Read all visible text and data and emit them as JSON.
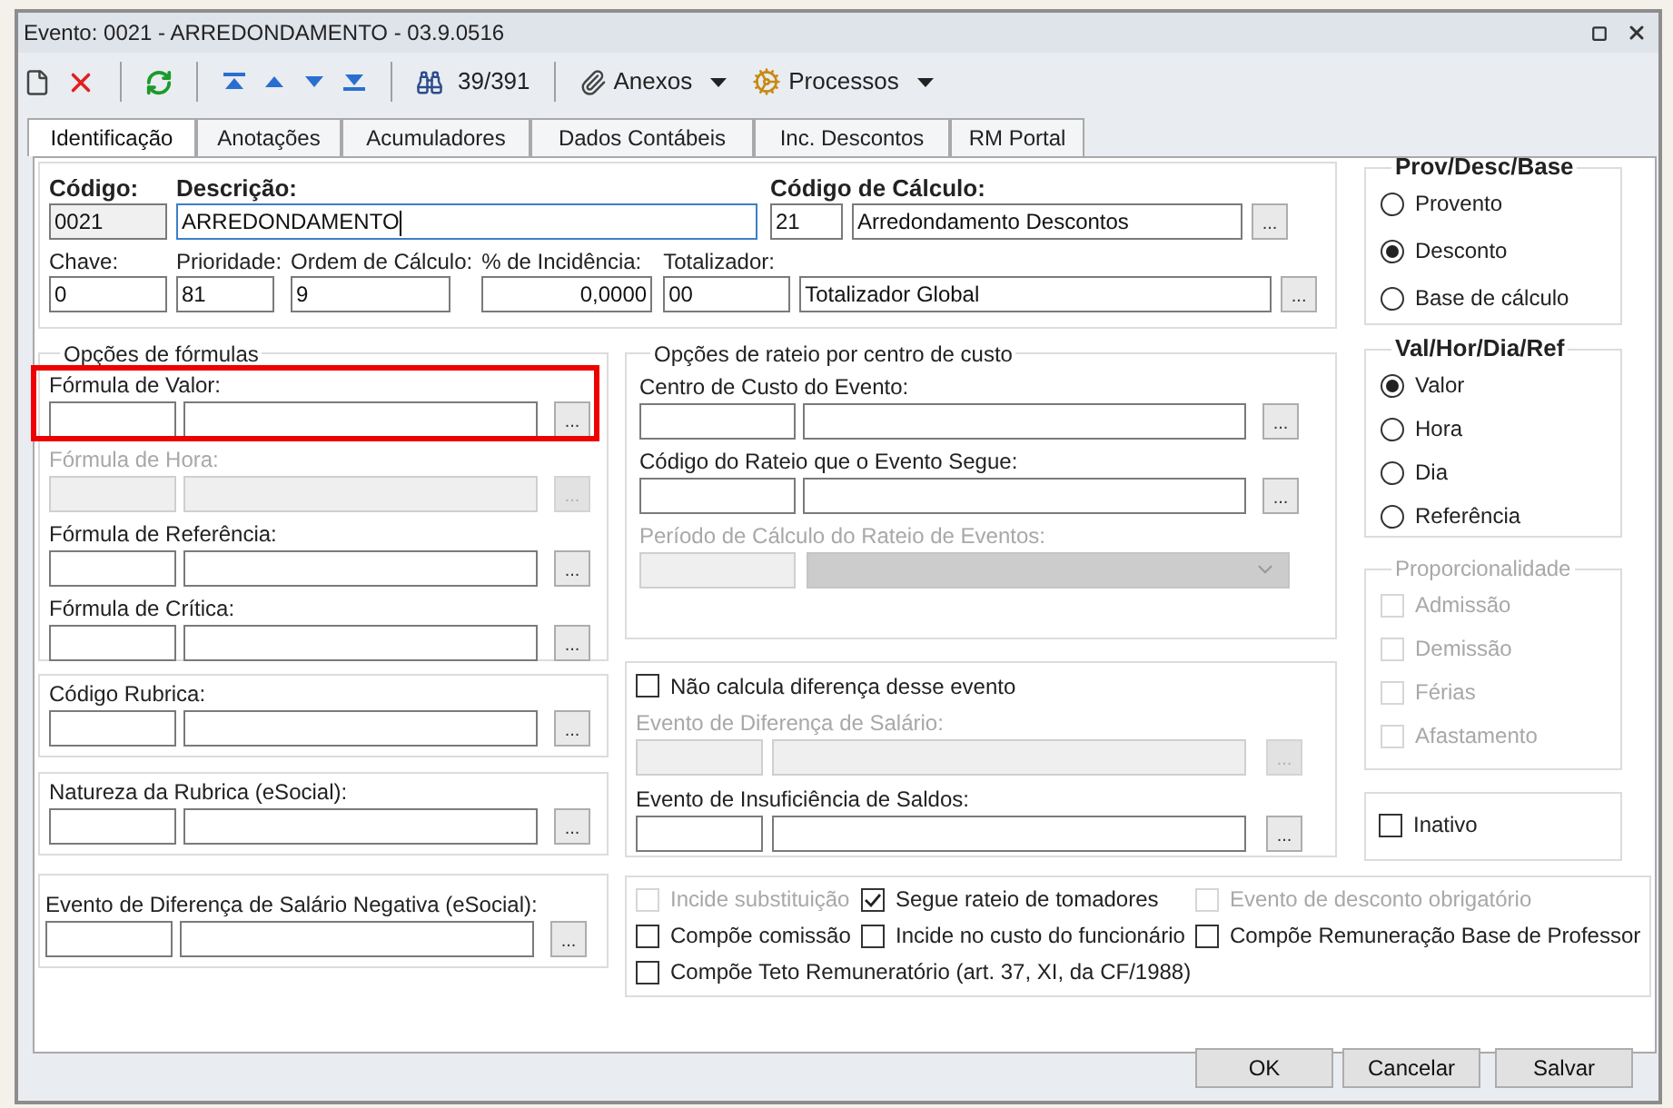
{
  "window": {
    "title": "Evento: 0021 - ARREDONDAMENTO - 03.9.0516"
  },
  "toolbar": {
    "record_counter": "39/391",
    "menus": [
      {
        "label": "Anexos",
        "kind": "attach"
      },
      {
        "label": "Processos",
        "kind": "process"
      }
    ]
  },
  "tabs": [
    {
      "label": "Identificação",
      "selected": true
    },
    {
      "label": "Anotações",
      "selected": false
    },
    {
      "label": "Acumuladores",
      "selected": false
    },
    {
      "label": "Dados Contábeis",
      "selected": false
    },
    {
      "label": "Inc. Descontos",
      "selected": false
    },
    {
      "label": "RM Portal",
      "selected": false
    }
  ],
  "header": {
    "codigo": {
      "label": "Código:",
      "value": "0021",
      "readonly": true
    },
    "descricao": {
      "label": "Descrição:",
      "value": "ARREDONDAMENTO",
      "focused": true
    },
    "codigo_calculo": {
      "label": "Código de Cálculo:",
      "code": "21",
      "description": "Arredondamento Descontos",
      "button": "..."
    },
    "chave": {
      "label": "Chave:",
      "value": "0"
    },
    "prioridade": {
      "label": "Prioridade:",
      "value": "81"
    },
    "ordem_calculo": {
      "label": "Ordem de Cálculo:",
      "value": "9"
    },
    "incidencia": {
      "label": "% de Incidência:",
      "value": "0,0000"
    },
    "totalizador": {
      "label": "Totalizador:",
      "code": "00",
      "description": "Totalizador Global",
      "button": "..."
    }
  },
  "formula_options": {
    "title": "Opções de fórmulas",
    "fields": [
      {
        "label": "Fórmula de Valor:",
        "button": "...",
        "disabled": false,
        "highlighted": true
      },
      {
        "label": "Fórmula de Hora:",
        "button": "...",
        "disabled": true,
        "highlighted": false
      },
      {
        "label": "Fórmula de Referência:",
        "button": "...",
        "disabled": false,
        "highlighted": false
      },
      {
        "label": "Fórmula de Crítica:",
        "button": "...",
        "disabled": false,
        "highlighted": false
      }
    ]
  },
  "codigo_rubrica": {
    "label": "Código Rubrica:",
    "button": "..."
  },
  "natureza_rubrica": {
    "label": "Natureza da Rubrica (eSocial):",
    "button": "..."
  },
  "evento_diferenca_negativa": {
    "label": "Evento de Diferença de Salário Negativa (eSocial):",
    "button": "..."
  },
  "rateio": {
    "title": "Opções de rateio por centro de custo",
    "fields": [
      {
        "label": "Centro de Custo do Evento:",
        "button": "...",
        "disabled": false
      },
      {
        "label": "Código do Rateio que o Evento Segue:",
        "button": "...",
        "disabled": false
      }
    ],
    "periodo": {
      "label": "Período de Cálculo do Rateio de Eventos:",
      "disabled": true
    }
  },
  "diferenca": {
    "checkbox": {
      "label": "Não calcula diferença desse evento",
      "checked": false
    },
    "fields": [
      {
        "label": "Evento de Diferença de Salário:",
        "button": "...",
        "disabled": true
      },
      {
        "label": "Evento de Insuficiência de Saldos:",
        "button": "...",
        "disabled": false
      }
    ]
  },
  "prov_desc_base": {
    "title": "Prov/Desc/Base",
    "options": [
      {
        "label": "Provento",
        "selected": false
      },
      {
        "label": "Desconto",
        "selected": true
      },
      {
        "label": "Base de cálculo",
        "selected": false
      }
    ]
  },
  "val_hor_dia_ref": {
    "title": "Val/Hor/Dia/Ref",
    "options": [
      {
        "label": "Valor",
        "selected": true
      },
      {
        "label": "Hora",
        "selected": false
      },
      {
        "label": "Dia",
        "selected": false
      },
      {
        "label": "Referência",
        "selected": false
      }
    ]
  },
  "proporcionalidade": {
    "title": "Proporcionalidade",
    "disabled": true,
    "items": [
      {
        "label": "Admissão",
        "checked": false
      },
      {
        "label": "Demissão",
        "checked": false
      },
      {
        "label": "Férias",
        "checked": false
      },
      {
        "label": "Afastamento",
        "checked": false
      }
    ]
  },
  "inativo": {
    "label": "Inativo",
    "checked": false
  },
  "flags": [
    {
      "label": "Incide substituição",
      "checked": false,
      "disabled": true
    },
    {
      "label": "Segue rateio de tomadores",
      "checked": true,
      "disabled": false
    },
    {
      "label": "Evento de desconto obrigatório",
      "checked": false,
      "disabled": true
    },
    {
      "label": "Compõe comissão",
      "checked": false,
      "disabled": false
    },
    {
      "label": "Incide no custo do funcionário",
      "checked": false,
      "disabled": false
    },
    {
      "label": "Compõe Remuneração Base de Professor",
      "checked": false,
      "disabled": false
    },
    {
      "label": "Compõe Teto Remuneratório (art. 37, XI, da CF/1988)",
      "checked": false,
      "disabled": false
    }
  ],
  "buttons": [
    "OK",
    "Cancelar",
    "Salvar"
  ]
}
